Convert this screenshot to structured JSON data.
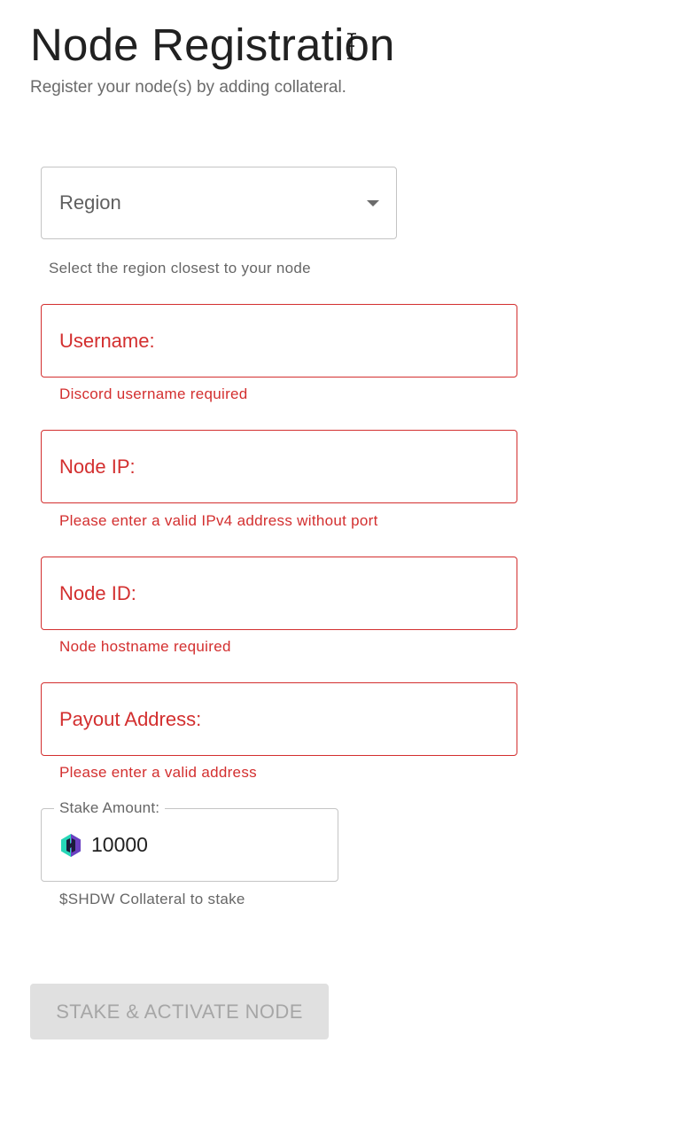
{
  "header": {
    "title": "Node Registration",
    "subtitle": "Register your node(s) by adding collateral."
  },
  "form": {
    "region": {
      "label": "Region",
      "helper": "Select the region closest to your node"
    },
    "username": {
      "placeholder": "Username:",
      "value": "",
      "error": "Discord username required"
    },
    "node_ip": {
      "placeholder": "Node IP:",
      "value": "",
      "error": "Please enter a valid IPv4 address without port"
    },
    "node_id": {
      "placeholder": "Node ID:",
      "value": "",
      "error": "Node hostname required"
    },
    "payout_address": {
      "placeholder": "Payout Address:",
      "value": "",
      "error": "Please enter a valid address"
    },
    "stake_amount": {
      "label": "Stake Amount:",
      "value": "10000",
      "icon": "shdw-token-icon",
      "helper": "$SHDW Collateral to stake"
    },
    "submit_label": "STAKE & ACTIVATE NODE"
  },
  "colors": {
    "error": "#d32f2f",
    "border": "#c4c4c4",
    "disabled_bg": "#e0e0e0",
    "disabled_text": "#a6a6a6",
    "token_teal": "#27d6b7",
    "token_purple": "#6a3fc1"
  }
}
